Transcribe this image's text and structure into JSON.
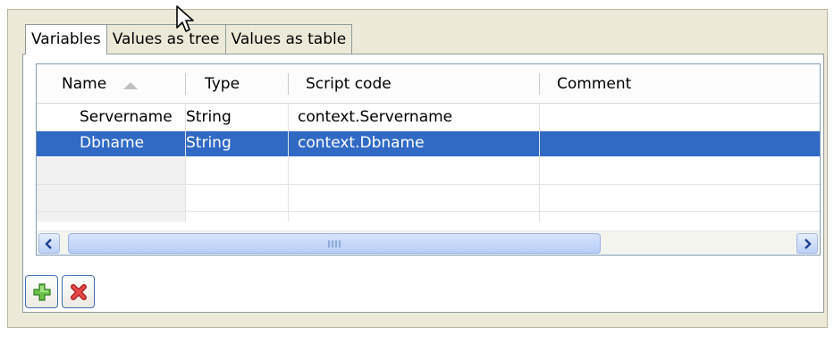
{
  "tabs": [
    {
      "label": "Variables",
      "active": true
    },
    {
      "label": "Values as tree",
      "active": false
    },
    {
      "label": "Values as table",
      "active": false
    }
  ],
  "table": {
    "columns": [
      "Name",
      "Type",
      "Script code",
      "Comment"
    ],
    "sort_column": "Name",
    "rows": [
      {
        "name": "Servername",
        "type": "String",
        "script": "context.Servername",
        "comment": "",
        "selected": false
      },
      {
        "name": "Dbname",
        "type": "String",
        "script": "context.Dbname",
        "comment": "",
        "selected": true
      }
    ],
    "selection_color": "#316ac5"
  },
  "scrollbar": {
    "left_icon": "chevron-left-icon",
    "right_icon": "chevron-right-icon"
  },
  "buttons": {
    "add_icon": "plus-icon",
    "remove_icon": "delete-x-icon"
  }
}
